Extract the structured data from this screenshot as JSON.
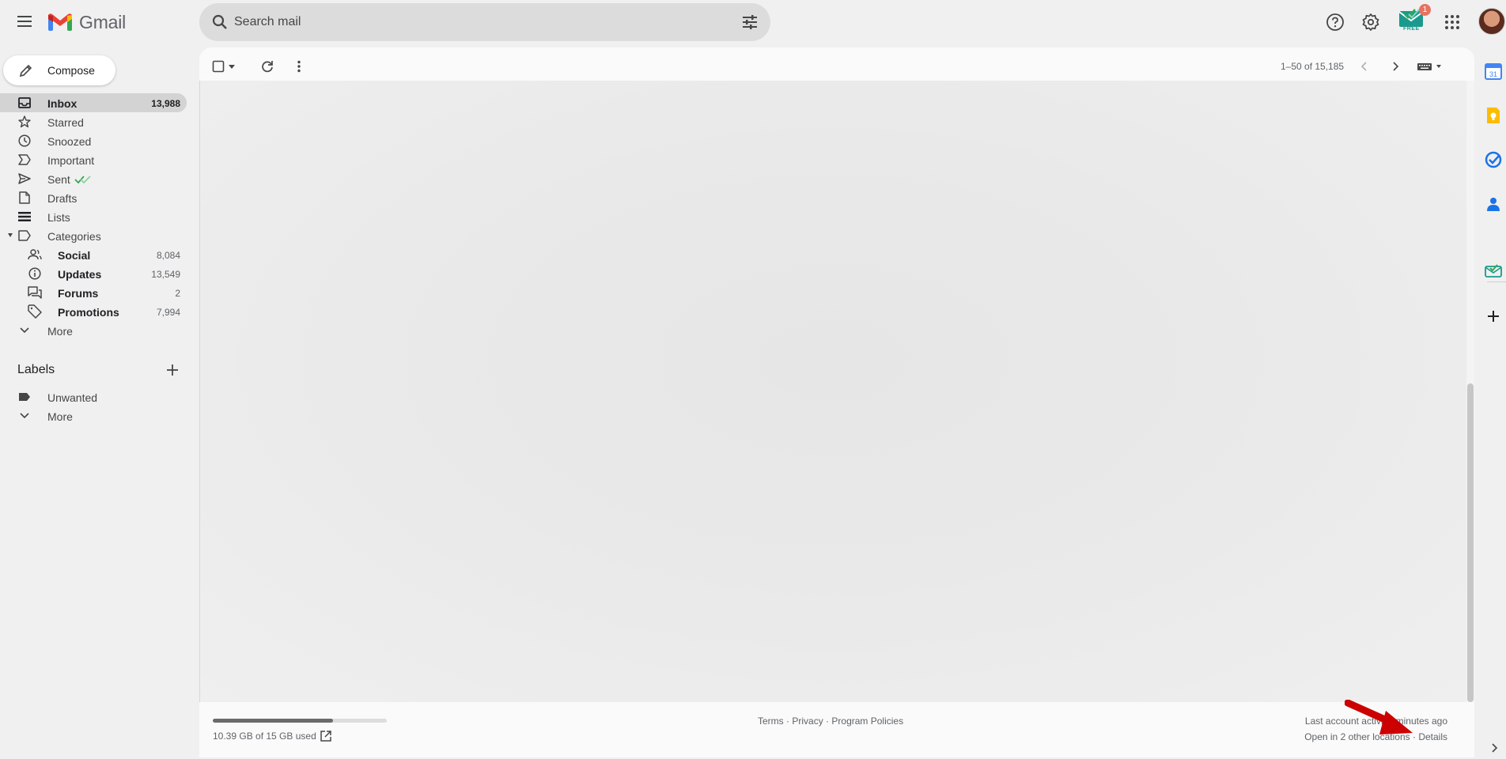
{
  "app": {
    "name": "Gmail"
  },
  "search": {
    "placeholder": "Search mail"
  },
  "top_icons": [
    "help-icon",
    "settings-icon",
    "apps-icon"
  ],
  "extension": {
    "badge_count": "1",
    "tag": "FREE"
  },
  "compose": {
    "label": "Compose"
  },
  "nav": {
    "inbox": {
      "label": "Inbox",
      "count": "13,988"
    },
    "starred": {
      "label": "Starred"
    },
    "snoozed": {
      "label": "Snoozed"
    },
    "important": {
      "label": "Important"
    },
    "sent": {
      "label": "Sent"
    },
    "drafts": {
      "label": "Drafts"
    },
    "lists": {
      "label": "Lists"
    },
    "categories": {
      "label": "Categories"
    },
    "social": {
      "label": "Social",
      "count": "8,084"
    },
    "updates": {
      "label": "Updates",
      "count": "13,549"
    },
    "forums": {
      "label": "Forums",
      "count": "2"
    },
    "promotions": {
      "label": "Promotions",
      "count": "7,994"
    },
    "more": {
      "label": "More"
    }
  },
  "labels": {
    "heading": "Labels",
    "items": [
      {
        "label": "Unwanted"
      }
    ],
    "more": "More"
  },
  "toolbar": {
    "pager": "1–50 of 15,185"
  },
  "footer": {
    "storage_used": "10.39 GB of 15 GB used",
    "storage_fraction": 0.69,
    "terms": "Terms",
    "privacy": "Privacy",
    "policies": "Program Policies",
    "sep": "·",
    "last_activity": "Last account activity: minutes ago",
    "open_other": "Open in 2 other locations",
    "details": "Details"
  },
  "colors": {
    "annotation_arrow": "#cc0000",
    "sent_check": "#34a853"
  }
}
